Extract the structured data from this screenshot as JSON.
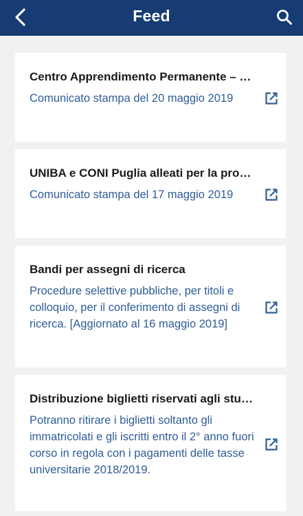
{
  "header": {
    "title": "Feed",
    "back_icon": "chevron-left-icon",
    "search_icon": "search-icon"
  },
  "feed": {
    "items": [
      {
        "title": "Centro Apprendimento Permanente – CAP",
        "description": "Comunicato stampa del 20 maggio 2019"
      },
      {
        "title": "UNIBA e CONI Puglia alleati per la promozione dello sport",
        "description": "Comunicato stampa del 17 maggio 2019"
      },
      {
        "title": "Bandi per assegni di ricerca",
        "description": "Procedure selettive pubbliche, per titoli e colloquio, per il conferimento di assegni di ricerca. [Aggiornato al 16 maggio 2019]"
      },
      {
        "title": "Distribuzione biglietti riservati agli studenti",
        "description": "Potranno ritirare i biglietti soltanto gli immatricolati e gli iscritti entro il 2° anno fuori corso in regola con i pagamenti delle tasse universitarie 2018/2019."
      }
    ],
    "open_icon": "external-link-icon"
  },
  "colors": {
    "header_bg": "#163c73",
    "page_bg": "#f1f1f3",
    "card_bg": "#ffffff",
    "title_text": "#1a1a1a",
    "description_text": "#2f5c97",
    "icon": "#2f5c97"
  }
}
